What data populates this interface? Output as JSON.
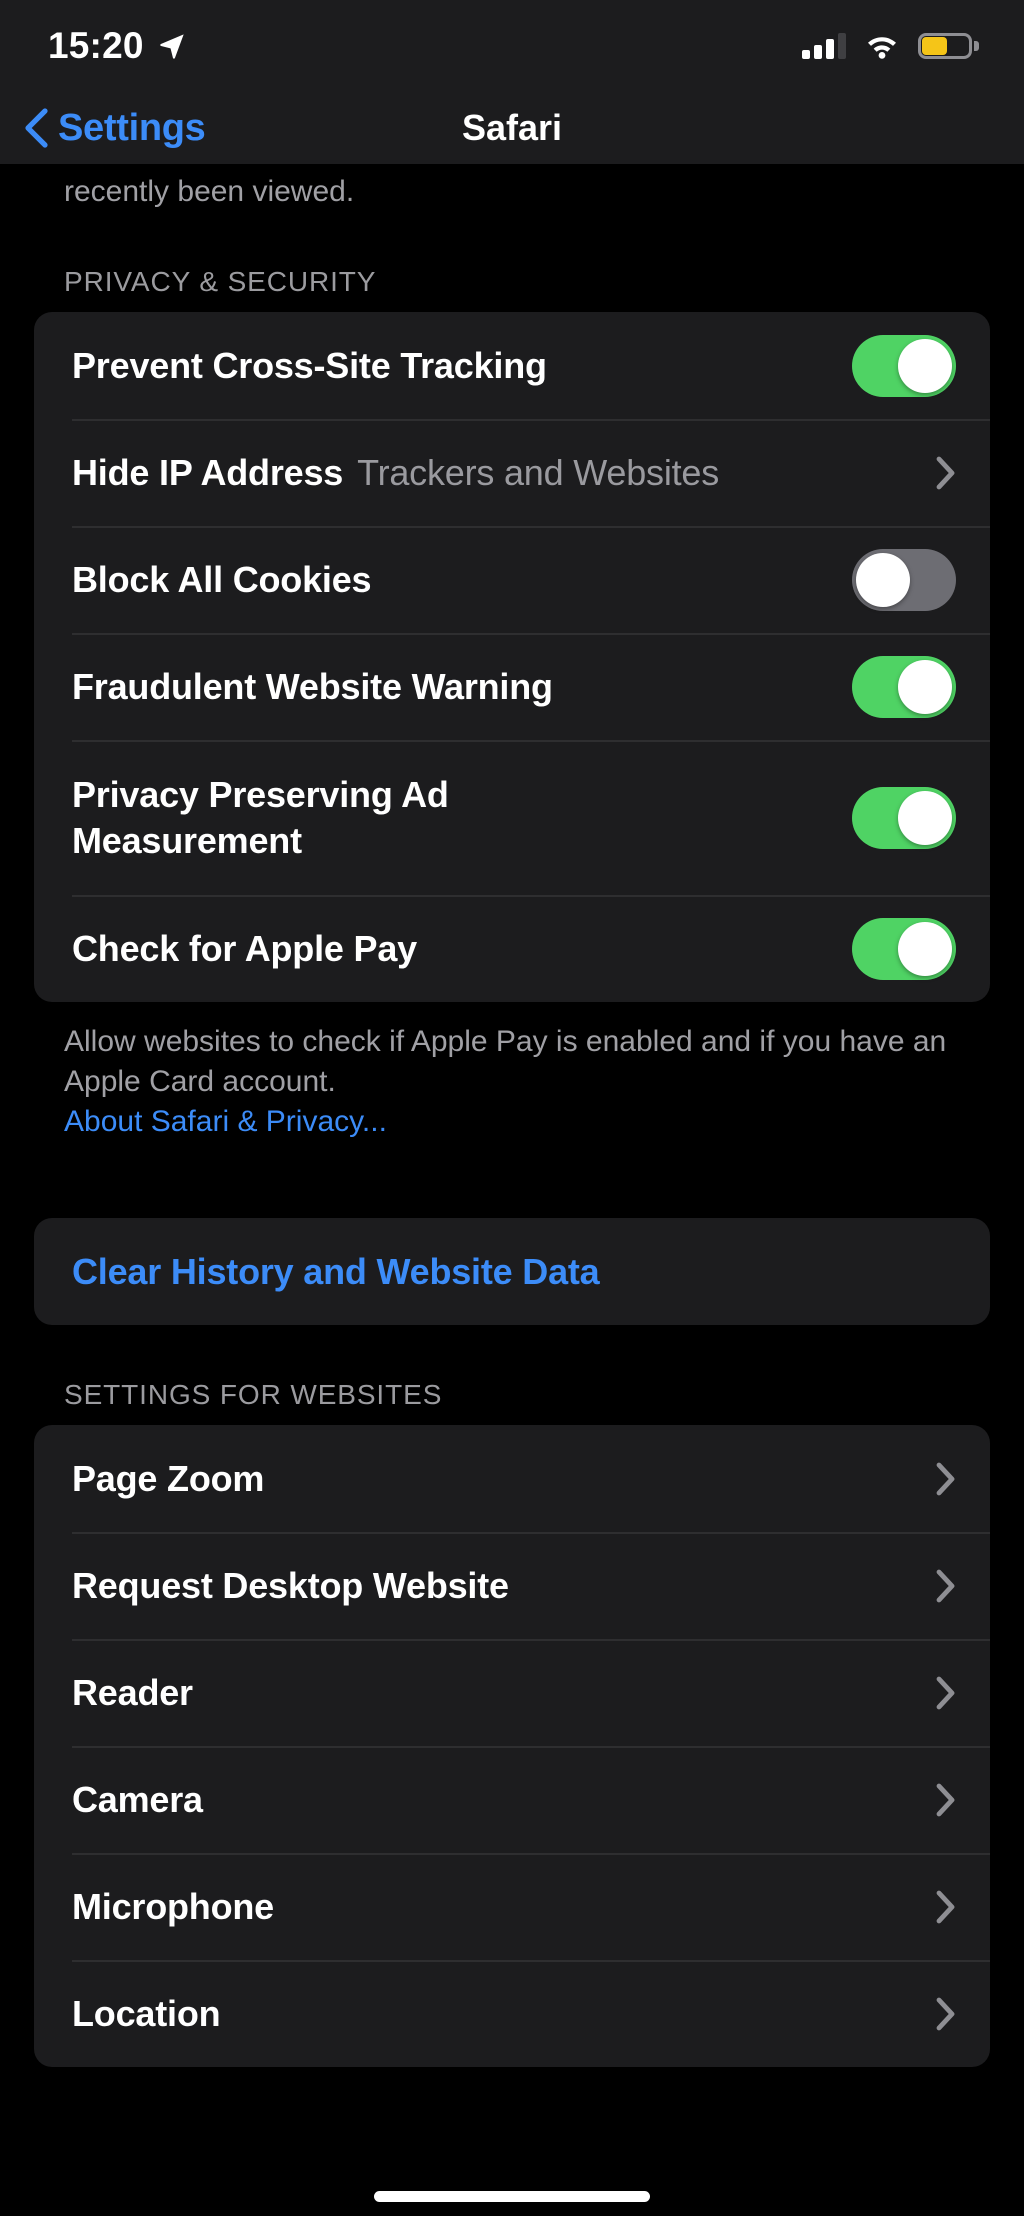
{
  "status_bar": {
    "time": "15:20",
    "location_icon": "location-arrow-icon",
    "cellular_icon": "cellular-signal-icon",
    "cellular_bars_filled": 3,
    "cellular_bars_total": 4,
    "wifi_icon": "wifi-icon",
    "battery_icon": "battery-icon",
    "battery_level_percent": 55,
    "battery_color": "#f5c518",
    "low_power_mode": true
  },
  "nav": {
    "back_label": "Settings",
    "back_icon": "chevron-left-icon",
    "title": "Safari"
  },
  "top_footer": {
    "text": "recently been viewed."
  },
  "privacy_section": {
    "header": "PRIVACY & SECURITY",
    "rows": [
      {
        "label": "Prevent Cross-Site Tracking",
        "control": "toggle",
        "value": "on"
      },
      {
        "label": "Hide IP Address",
        "control": "disclosure",
        "value": "Trackers and Websites"
      },
      {
        "label": "Block All Cookies",
        "control": "toggle",
        "value": "off"
      },
      {
        "label": "Fraudulent Website Warning",
        "control": "toggle",
        "value": "on"
      },
      {
        "label": "Privacy Preserving Ad Measurement",
        "control": "toggle",
        "value": "on"
      },
      {
        "label": "Check for Apple Pay",
        "control": "toggle",
        "value": "on"
      }
    ],
    "footer_line1": "Allow websites to check if Apple Pay is enabled and",
    "footer_line2": "if you have an Apple Card account.",
    "footer_link": "About Safari & Privacy..."
  },
  "clear_action": {
    "label": "Clear History and Website Data"
  },
  "websites_section": {
    "header": "SETTINGS FOR WEBSITES",
    "rows": [
      {
        "label": "Page Zoom"
      },
      {
        "label": "Request Desktop Website"
      },
      {
        "label": "Reader"
      },
      {
        "label": "Camera"
      },
      {
        "label": "Microphone"
      },
      {
        "label": "Location"
      }
    ]
  },
  "colors": {
    "page_background": "#000000",
    "cell_background": "#1c1c1e",
    "accent_blue": "#3c8cf8",
    "toggle_on_green": "#4fd364",
    "toggle_off_gray": "#6d6d73",
    "secondary_text": "#9a9a9f",
    "separator": "#2e2e30"
  }
}
